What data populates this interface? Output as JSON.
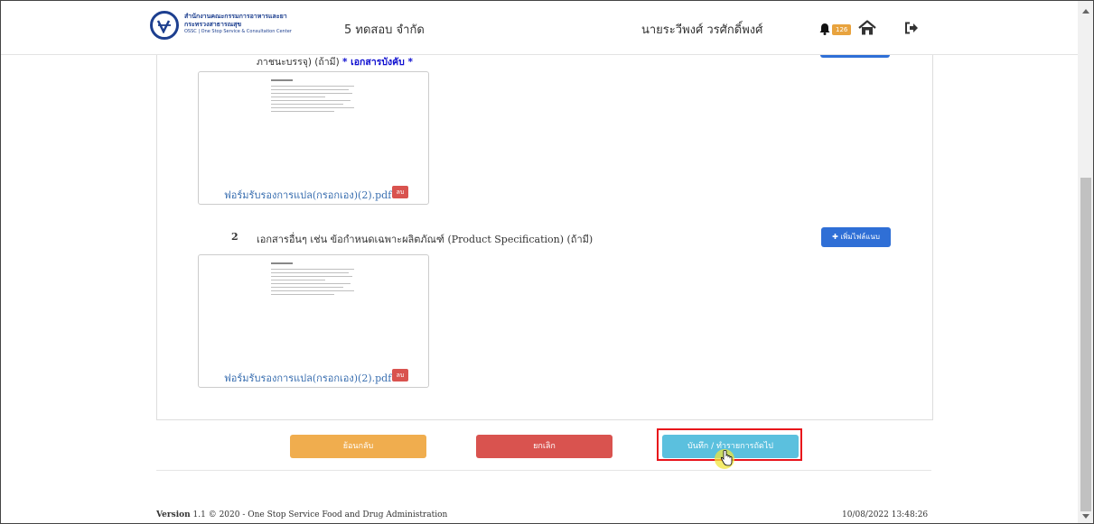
{
  "header": {
    "logo_line1": "สำนักงานคณะกรรมการอาหารและยา",
    "logo_line2": "กระทรวงสาธารณสุข",
    "logo_line3": "OSSC | One Stop Service & Consultation Center",
    "company_name": "5 ทดสอบ จำกัด",
    "user_name": "นายระวีพงศ์ วรศักดิ์พงศ์",
    "notification_count": "126",
    "icons": [
      "bell-icon",
      "home-icon",
      "logout-icon"
    ]
  },
  "document_section": {
    "required_text_prefix": "ภาชนะบรรจุ) (ถ้ามี)",
    "required_label": "* เอกสารบังคับ *",
    "first_file": {
      "file_name": "ฟอร์มรับรองการแปล(กรอกเอง)(2).pdf",
      "delete_label": "ลบ"
    },
    "item2": {
      "number": "2",
      "title": "เอกสารอื่นๆ เช่น ข้อกำหนดเฉพาะผลิตภัณฑ์ (Product Specification) (ถ้ามี)",
      "add_button_label": "✚ เพิ่มไฟล์แนบ",
      "file": {
        "file_name": "ฟอร์มรับรองการแปล(กรอกเอง)(2).pdf",
        "delete_label": "ลบ"
      }
    }
  },
  "actions": {
    "back_label": "ย้อนกลับ",
    "cancel_label": "ยกเลิก",
    "save_label": "บันทึก / ทำรายการถัดไป"
  },
  "footer": {
    "version_label": "Version",
    "version_text": "1.1 © 2020 - One Stop Service Food and Drug Administration",
    "datetime": "10/08/2022 13:48:26"
  },
  "colors": {
    "primary": "#2f6fd6",
    "back": "#f0ad4e",
    "cancel": "#d9534f",
    "save": "#5bc0de",
    "highlight": "#e8141b"
  }
}
